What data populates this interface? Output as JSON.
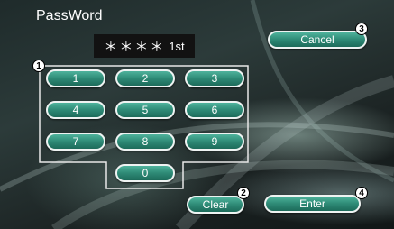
{
  "screen": {
    "title": "PassWord"
  },
  "display": {
    "mask": "＊＊＊＊",
    "index": "1st"
  },
  "keypad": {
    "keys": [
      "1",
      "2",
      "3",
      "4",
      "5",
      "6",
      "7",
      "8",
      "9",
      "0"
    ]
  },
  "buttons": {
    "cancel": "Cancel",
    "clear": "Clear",
    "enter": "Enter"
  },
  "callouts": [
    "1",
    "2",
    "3",
    "4"
  ]
}
